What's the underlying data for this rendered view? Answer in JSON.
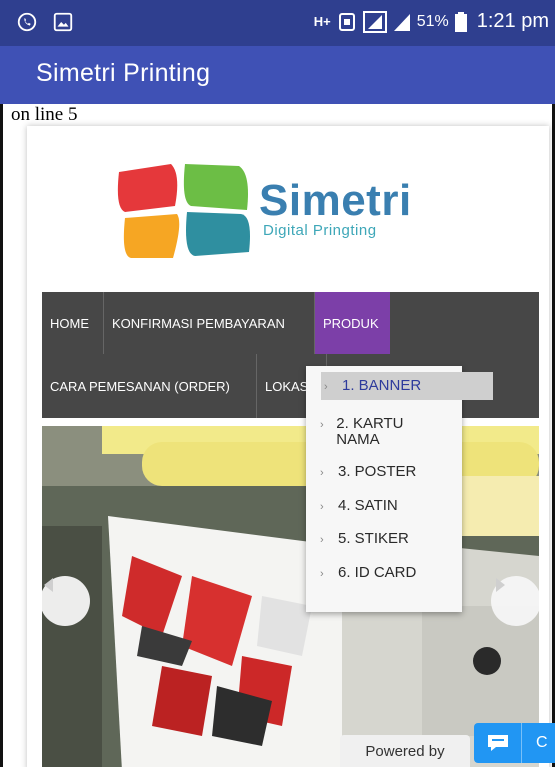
{
  "status_bar": {
    "left_icons": [
      "whatsapp-icon",
      "image-icon"
    ],
    "network": "H+",
    "battery_pct": "51%",
    "time": "1:21 pm"
  },
  "app_bar": {
    "title": "Simetri Printing"
  },
  "error_text": "on line 5",
  "logo": {
    "brand": "Simetri",
    "tagline": "Digital Pringting"
  },
  "nav": {
    "items": [
      {
        "label": "HOME"
      },
      {
        "label": "KONFIRMASI PEMBAYARAN"
      },
      {
        "label": "PRODUK",
        "active": true
      },
      {
        "label": "CARA PEMESANAN (ORDER)"
      },
      {
        "label": "LOKAS"
      }
    ]
  },
  "dropdown": {
    "items": [
      {
        "label": "1. BANNER",
        "selected": true
      },
      {
        "label": "2. KARTU NAMA"
      },
      {
        "label": "3. POSTER"
      },
      {
        "label": "4. SATIN"
      },
      {
        "label": "5. STIKER"
      },
      {
        "label": "6. ID CARD"
      }
    ]
  },
  "footer": {
    "powered_by": "Powered by",
    "chat_label": "C"
  },
  "colors": {
    "status_bar": "#2f3f8f",
    "app_bar": "#3f51b5",
    "nav_bg": "#474747",
    "nav_active": "#7c3fa8",
    "chat": "#2196f3"
  }
}
